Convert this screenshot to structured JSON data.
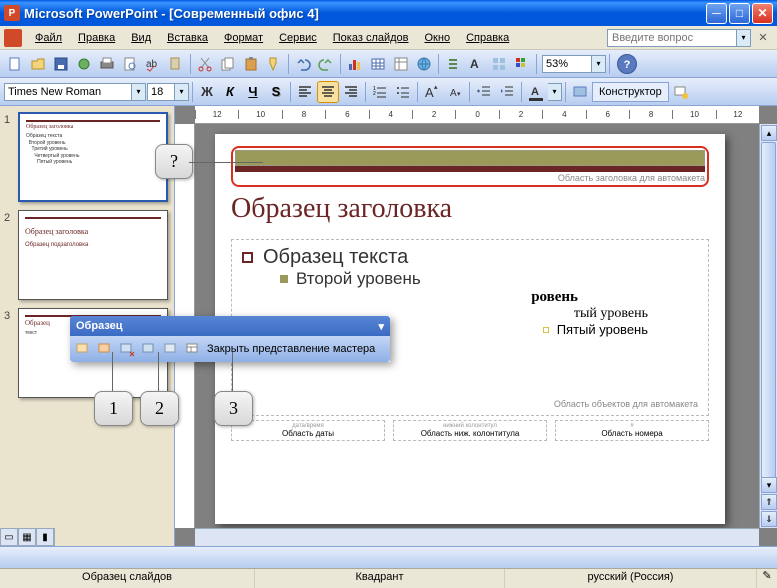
{
  "title": "Microsoft PowerPoint - [Современный офис 4]",
  "menu": {
    "file": "Файл",
    "edit": "Правка",
    "view": "Вид",
    "insert": "Вставка",
    "format": "Формат",
    "tools": "Сервис",
    "slideshow": "Показ слайдов",
    "window": "Окно",
    "help": "Справка"
  },
  "search_placeholder": "Введите вопрос",
  "zoom": "53%",
  "font": {
    "name": "Times New Roman",
    "size": "18"
  },
  "designer_label": "Конструктор",
  "ruler_values": [
    "12",
    "10",
    "8",
    "6",
    "4",
    "2",
    "0",
    "2",
    "4",
    "6",
    "8",
    "10",
    "12"
  ],
  "thumbs": [
    {
      "num": "1",
      "title": "Образец заголовка",
      "body": "Образец текста\n  Второй уровень\n    Третий уровень\n      Четвертый уровень\n        Пятый уровень"
    },
    {
      "num": "2",
      "title": "Образец заголовка",
      "body": "Образец подзаголовка"
    },
    {
      "num": "3",
      "title": "Образец",
      "body": "текст"
    }
  ],
  "float_toolbar": {
    "title": "Образец",
    "close": "Закрыть представление мастера"
  },
  "slide": {
    "title_caption": "Область заголовка для автомакета",
    "title": "Образец заголовка",
    "lvl1": "Образец текста",
    "lvl2": "Второй уровень",
    "lvl3": "ровень",
    "lvl4": "тый уровень",
    "lvl5": "Пятый уровень",
    "body_caption": "Область объектов для автомакета",
    "date_tiny": "дата/время",
    "date": "Область даты",
    "footer_tiny": "нижний колонтитул",
    "footer": "Область ниж. колонтитула",
    "num_tiny": "#",
    "num": "Область номера"
  },
  "callouts": {
    "q": "?",
    "c1": "1",
    "c2": "2",
    "c3": "3"
  },
  "status": {
    "slides": "Образец слайдов",
    "layout": "Квадрант",
    "lang": "русский (Россия)"
  }
}
